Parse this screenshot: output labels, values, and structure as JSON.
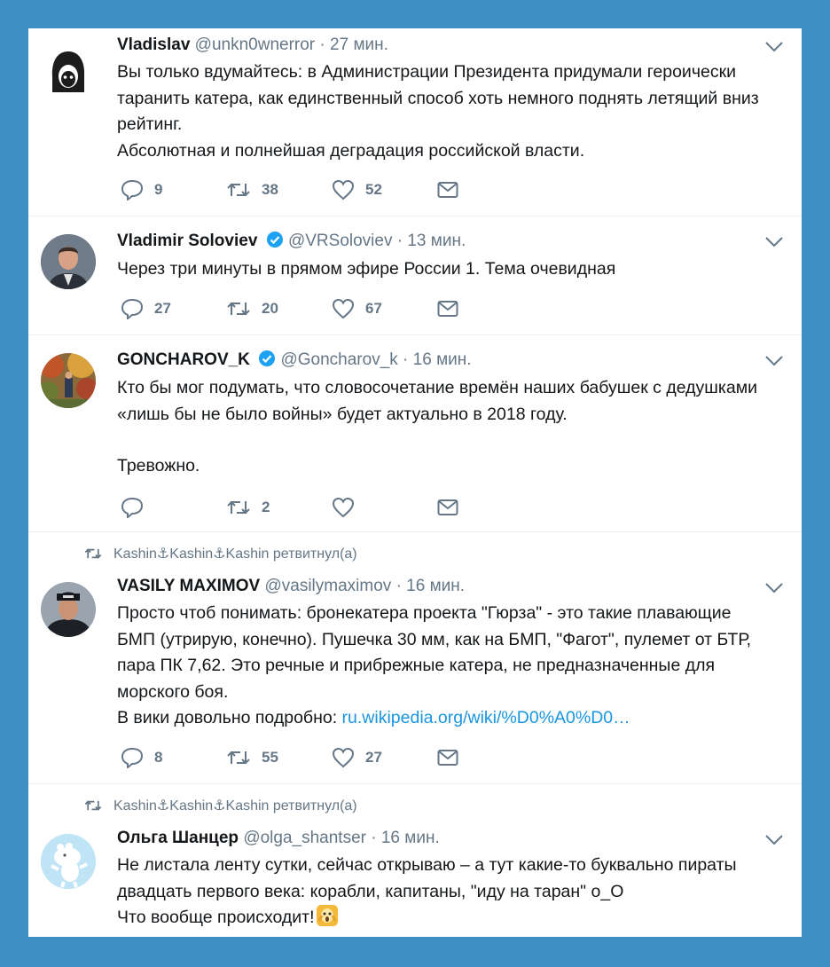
{
  "colors": {
    "background": "#3b8fc4",
    "panel": "#ffffff",
    "text": "#14171a",
    "secondary": "#657786",
    "link": "#1b95e0",
    "verified": "#1da1f2"
  },
  "tweets": [
    {
      "name": "Vladislav",
      "handle": "@unkn0wnerror",
      "separator": "·",
      "time": "27 мин.",
      "text": [
        "Вы только вдумайтесь: в Администрации Президента придумали героически таранить катера, как единственный способ хоть немного поднять летящий вниз рейтинг.",
        "Абсолютная и полнейшая деградация российской власти."
      ],
      "replies": "9",
      "retweets": "38",
      "likes": "52"
    },
    {
      "name": "Vladimir Soloviev",
      "verified": true,
      "handle": "@VRSoloviev",
      "separator": "·",
      "time": "13 мин.",
      "text": [
        "Через три минуты в прямом эфире России 1. Тема очевидная"
      ],
      "replies": "27",
      "retweets": "20",
      "likes": "67"
    },
    {
      "name": "GONCHAROV_K",
      "verified": true,
      "handle": "@Goncharov_k",
      "separator": "·",
      "time": "16 мин.",
      "text": [
        "Кто бы мог подумать, что словосочетание времён наших бабушек с дедушками «лишь бы не было войны» будет актуально в 2018 году.",
        "Тревожно."
      ],
      "replies": "",
      "retweets": "2",
      "likes": ""
    },
    {
      "retweeted_by": "Kashin⚓Kashin⚓Kashin ретвитнул(а)",
      "name": "VASILY MAXIMOV",
      "handle": "@vasilymaximov",
      "separator": "·",
      "time": "16 мин.",
      "text": [
        "Просто чтоб понимать: бронекатера проекта \"Гюрза\" - это такие плавающие БМП (утрирую, конечно). Пушечка 30 мм, как на БМП, \"Фагот\", пулемет от БТР, пара ПК 7,62. Это речные и прибрежные катера, не предназначенные для морского боя."
      ],
      "link_prefix": "В вики довольно подробно: ",
      "link": "ru.wikipedia.org/wiki/%D0%A0%D0…",
      "replies": "8",
      "retweets": "55",
      "likes": "27"
    },
    {
      "retweeted_by": "Kashin⚓Kashin⚓Kashin ретвитнул(а)",
      "name": "Ольга Шанцер",
      "handle": "@olga_shantser",
      "separator": "·",
      "time": "16 мин.",
      "text": [
        "Не листала ленту сутки, сейчас открываю – а тут какие-то буквально пираты двадцать первого века: корабли, капитаны, \"иду на таран\" о_О"
      ],
      "last_line": "Что вообще происходит!",
      "emoji": "screaming-face-emoji"
    }
  ]
}
